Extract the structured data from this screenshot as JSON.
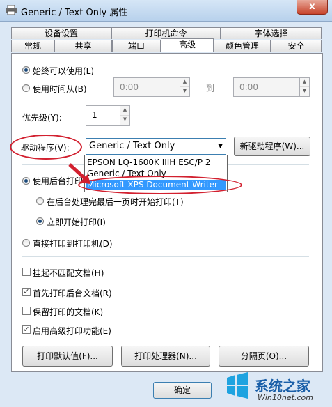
{
  "window": {
    "title": "Generic / Text Only 属性",
    "close_label": "x"
  },
  "tabs": {
    "row1": [
      "设备设置",
      "打印机命令",
      "字体选择"
    ],
    "row2": [
      "常规",
      "共享",
      "端口",
      "高级",
      "颜色管理",
      "安全"
    ],
    "active": "高级"
  },
  "availability": {
    "always_label": "始终可以使用(L)",
    "range_label": "使用时间从(B)",
    "from_value": "0:00",
    "to_label": "到",
    "to_value": "0:00",
    "selected": "always"
  },
  "priority": {
    "label": "优先级(Y):",
    "value": "1"
  },
  "driver": {
    "label": "驱动程序(V):",
    "value": "Generic / Text Only",
    "new_button": "新驱动程序(W)...",
    "options": [
      "EPSON LQ-1600K IIIH ESC/P 2",
      "Generic / Text Only",
      "Microsoft XPS Document Writer"
    ],
    "highlighted": "Microsoft XPS Document Writer"
  },
  "spool": {
    "use_spool_label": "使用后台打印",
    "after_last_page_label": "在后台处理完最后一页时开始打印(T)",
    "immediately_label": "立即开始打印(I)",
    "direct_label": "直接打印到打印机(D)"
  },
  "checks": [
    {
      "label": "挂起不匹配文档(H)",
      "checked": false
    },
    {
      "label": "首先打印后台文档(R)",
      "checked": true
    },
    {
      "label": "保留打印的文档(K)",
      "checked": false
    },
    {
      "label": "启用高级打印功能(E)",
      "checked": true
    }
  ],
  "buttons": {
    "defaults": "打印默认值(F)...",
    "processor": "打印处理器(N)...",
    "separator": "分隔页(O)...",
    "ok": "确定"
  },
  "watermark": {
    "brand": "系统之家",
    "url": "Win10net.com"
  },
  "colors": {
    "highlight": "#3399ff",
    "annotation": "#d2202f"
  }
}
